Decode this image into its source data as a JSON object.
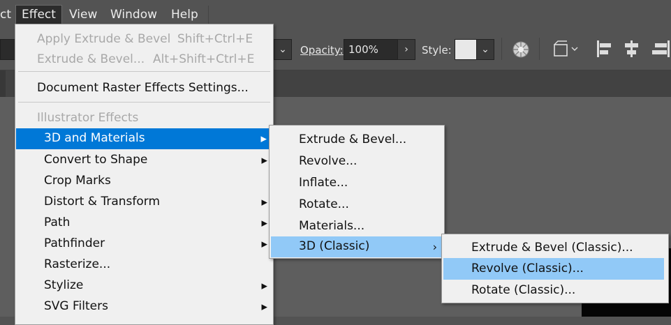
{
  "menubar": {
    "items": [
      "ct",
      "Effect",
      "View",
      "Window",
      "Help"
    ]
  },
  "toolbar": {
    "opacity_label": "Opacity:",
    "opacity_value": "100%",
    "style_label": "Style:"
  },
  "effect_menu": {
    "items": [
      {
        "label": "Apply Extrude & Bevel",
        "shortcut": "Shift+Ctrl+E",
        "disabled": true
      },
      {
        "label": "Extrude & Bevel...",
        "shortcut": "Alt+Shift+Ctrl+E",
        "disabled": true
      },
      {
        "label": "Document Raster Effects Settings..."
      },
      {
        "label": "Illustrator Effects",
        "header": true
      },
      {
        "label": "3D and Materials",
        "submenu": true,
        "highlighted": true
      },
      {
        "label": "Convert to Shape",
        "submenu": true
      },
      {
        "label": "Crop Marks"
      },
      {
        "label": "Distort & Transform",
        "submenu": true
      },
      {
        "label": "Path",
        "submenu": true
      },
      {
        "label": "Pathfinder",
        "submenu": true
      },
      {
        "label": "Rasterize..."
      },
      {
        "label": "Stylize",
        "submenu": true
      },
      {
        "label": "SVG Filters",
        "submenu": true
      }
    ]
  },
  "materials_submenu": {
    "items": [
      {
        "label": "Extrude & Bevel..."
      },
      {
        "label": "Revolve..."
      },
      {
        "label": "Inflate..."
      },
      {
        "label": "Rotate..."
      },
      {
        "label": "Materials..."
      },
      {
        "label": "3D (Classic)",
        "submenu": true,
        "highlighted": true
      }
    ]
  },
  "classic_submenu": {
    "items": [
      {
        "label": "Extrude & Bevel (Classic)..."
      },
      {
        "label": "Revolve (Classic)...",
        "highlighted": true
      },
      {
        "label": "Rotate (Classic)..."
      }
    ]
  },
  "colors": {
    "highlight": "#0078d7",
    "hover": "#91c9f7",
    "menu_bg": "#f0f0f0",
    "chrome": "#535353"
  }
}
